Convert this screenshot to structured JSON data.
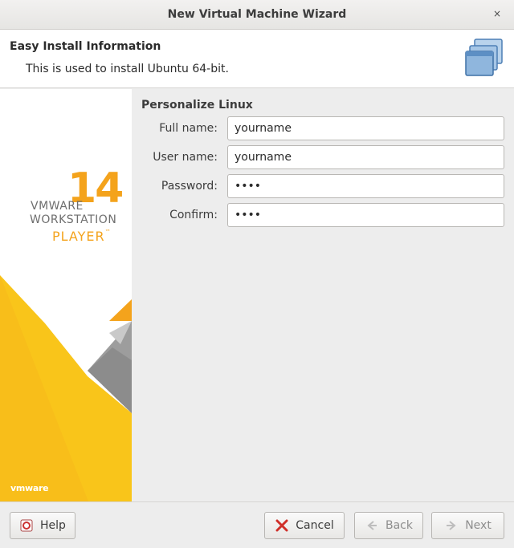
{
  "window": {
    "title": "New Virtual Machine Wizard",
    "close_glyph": "×"
  },
  "header": {
    "title": "Easy Install Information",
    "subtitle": "This is used to install Ubuntu 64-bit.",
    "icon": "vm-windows-icon"
  },
  "sidebar": {
    "brand_vmware": "VMWARE",
    "brand_version": "14",
    "brand_product": "WORKSTATION",
    "brand_edition": "PLAYER",
    "brand_tm": "™",
    "footer_logo": "vmware",
    "colors": {
      "accent": "#f4a31c",
      "yellow": "#f9c51a",
      "gray": "#9a9a9a"
    }
  },
  "form": {
    "section_title": "Personalize Linux",
    "fields": [
      {
        "label": "Full name:",
        "value": "yourname",
        "type": "text"
      },
      {
        "label": "User name:",
        "value": "yourname",
        "type": "text"
      },
      {
        "label": "Password:",
        "value": "pass",
        "type": "password"
      },
      {
        "label": "Confirm:",
        "value": "pass",
        "type": "password"
      }
    ]
  },
  "footer": {
    "help_label": "Help",
    "cancel_label": "Cancel",
    "back_label": "Back",
    "next_label": "Next"
  }
}
